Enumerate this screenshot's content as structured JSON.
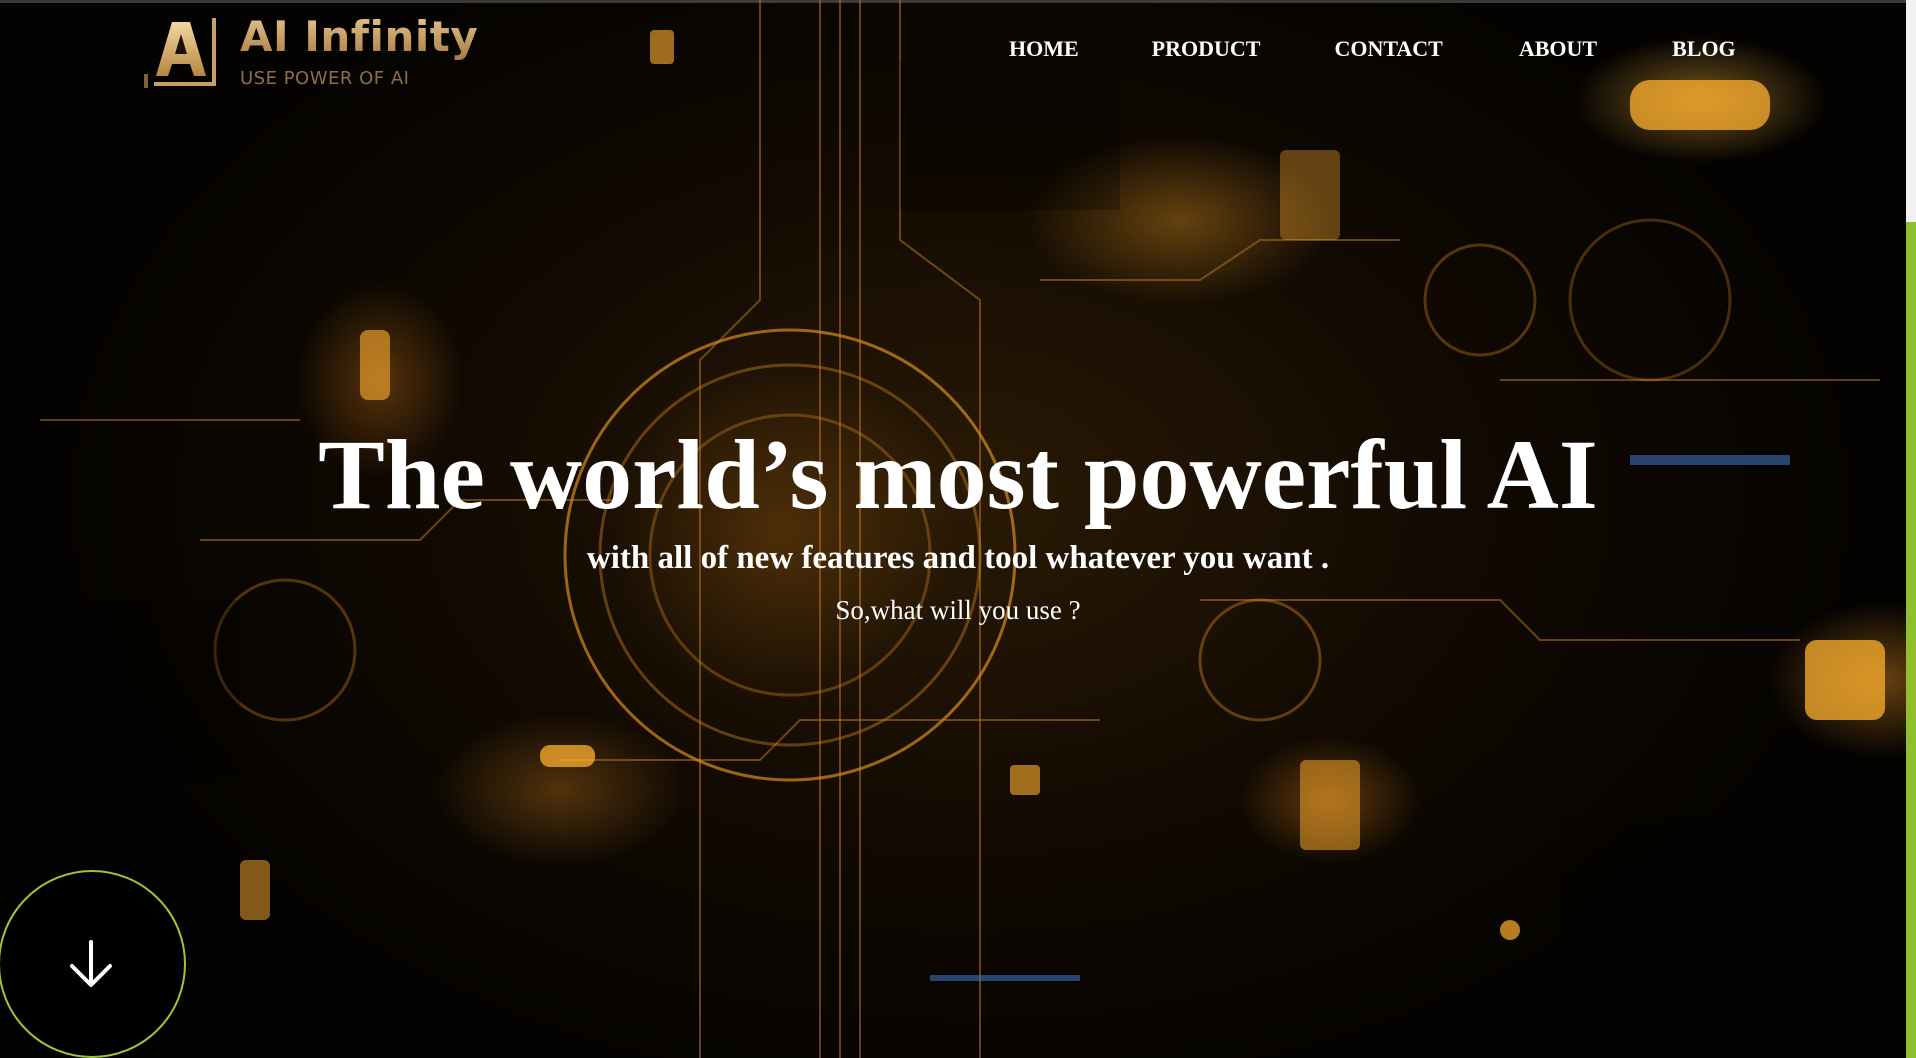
{
  "brand": {
    "name": "AI Infinity",
    "tagline": "USE POWER OF AI",
    "logo_letter": "A",
    "gold": "#c9a064"
  },
  "nav": {
    "items": [
      {
        "label": "HOME"
      },
      {
        "label": "PRODUCT"
      },
      {
        "label": "CONTACT"
      },
      {
        "label": "ABOUT"
      },
      {
        "label": "BLOG"
      }
    ]
  },
  "hero": {
    "title": "The world’s most powerful AI",
    "subtitle": "with all of new features and tool whatever you want .",
    "question": "So,what will you use ?"
  },
  "scroll_button": {
    "icon": "arrow-down-icon",
    "accent": "#9dc33a"
  },
  "scrollbar": {
    "thumb_color": "#8fbf2a"
  }
}
